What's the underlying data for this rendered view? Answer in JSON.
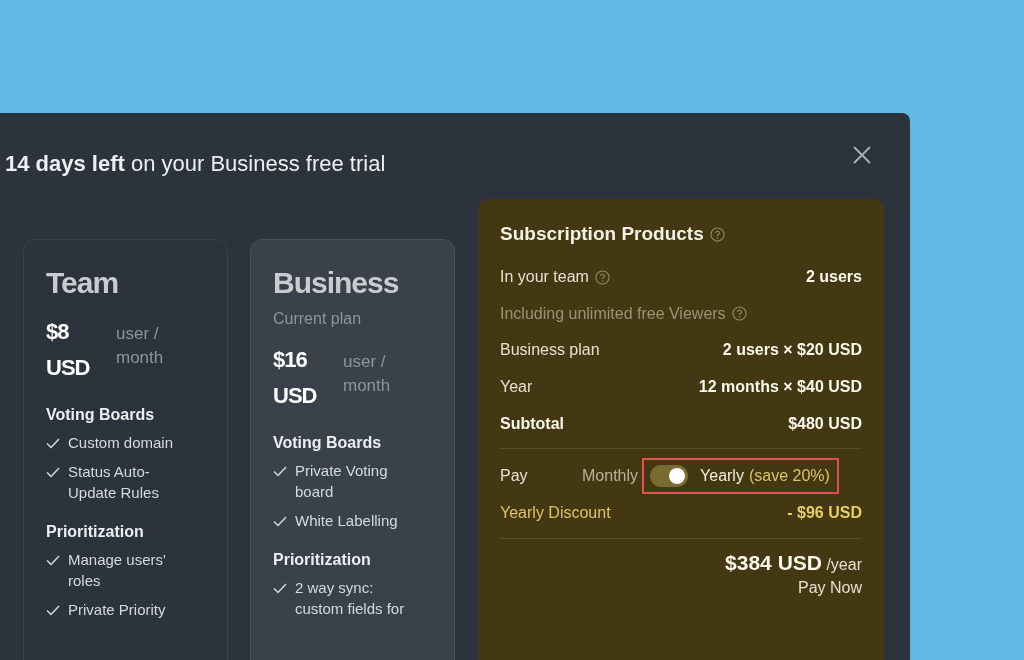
{
  "modal": {
    "title_bold": "14 days left",
    "title_rest": "on your Business free trial"
  },
  "plans": [
    {
      "name": "Team",
      "selected": false,
      "price": "$8",
      "currency": "USD",
      "per": "user / month",
      "sections": [
        {
          "heading": "Voting Boards",
          "items": [
            "Custom domain",
            "Status Auto-Update Rules"
          ]
        },
        {
          "heading": "Prioritization",
          "items": [
            "Manage users' roles",
            "Private Priority"
          ]
        }
      ]
    },
    {
      "name": "Business",
      "selected": true,
      "subtitle": "Current plan",
      "price": "$16",
      "currency": "USD",
      "per": "user / month",
      "sections": [
        {
          "heading": "Voting Boards",
          "items": [
            "Private Voting board",
            "White Labelling"
          ]
        },
        {
          "heading": "Prioritization",
          "items": [
            "2 way sync: custom fields for"
          ]
        }
      ]
    }
  ],
  "summary": {
    "title": "Subscription Products",
    "rows": [
      {
        "kind": "normal",
        "label": "In your team",
        "help": true,
        "value": "2 users"
      },
      {
        "kind": "muted",
        "label": "Including unlimited free Viewers",
        "help": true
      },
      {
        "kind": "normal",
        "label": "Business plan",
        "help": false,
        "value": "2 users × $20 USD"
      },
      {
        "kind": "normal",
        "label": "Year",
        "help": false,
        "value": "12 months × $40 USD"
      },
      {
        "kind": "total",
        "label": "Subtotal",
        "help": false,
        "value": "$480 USD"
      }
    ],
    "pay": {
      "label": "Pay",
      "left_option": "Monthly",
      "right_option": "Yearly",
      "save": "(save 20%)",
      "on": true
    },
    "discount": {
      "label": "Yearly Discount",
      "value": "- $96 USD"
    },
    "total": {
      "amount": "$384 USD",
      "period": "/year"
    },
    "action": "Pay Now"
  }
}
